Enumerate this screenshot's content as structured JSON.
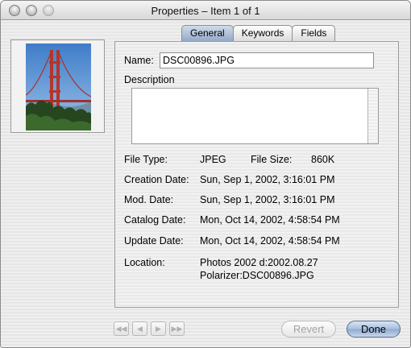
{
  "window": {
    "title": "Properties – Item 1 of 1"
  },
  "tabs": [
    {
      "label": "General",
      "active": true
    },
    {
      "label": "Keywords",
      "active": false
    },
    {
      "label": "Fields",
      "active": false
    }
  ],
  "general": {
    "name_label": "Name:",
    "name_value": "DSC00896.JPG",
    "description_label": "Description",
    "description_value": "",
    "file_type_label": "File Type:",
    "file_type_value": "JPEG",
    "file_size_label": "File Size:",
    "file_size_value": "860K",
    "creation_label": "Creation Date:",
    "creation_value": "Sun, Sep 1, 2002, 3:16:01 PM",
    "mod_label": "Mod. Date:",
    "mod_value": "Sun, Sep 1, 2002, 3:16:01 PM",
    "catalog_label": "Catalog Date:",
    "catalog_value": "Mon, Oct 14, 2002, 4:58:54 PM",
    "update_label": "Update Date:",
    "update_value": "Mon, Oct 14, 2002, 4:58:54 PM",
    "location_label": "Location:",
    "location_line1": "Photos 2002 d:2002.08.27",
    "location_line2": "Polarizer:DSC00896.JPG"
  },
  "footer": {
    "nav_icons": [
      "first-icon",
      "previous-icon",
      "next-icon",
      "last-icon"
    ],
    "nav_glyphs": [
      "◀◀",
      "◀",
      "▶",
      "▶▶"
    ],
    "revert_label": "Revert",
    "done_label": "Done"
  },
  "thumbnail": {
    "icon": "golden-gate-bridge-photo",
    "sky_color": "#5a8fd0",
    "bridge_color": "#c0392b"
  }
}
